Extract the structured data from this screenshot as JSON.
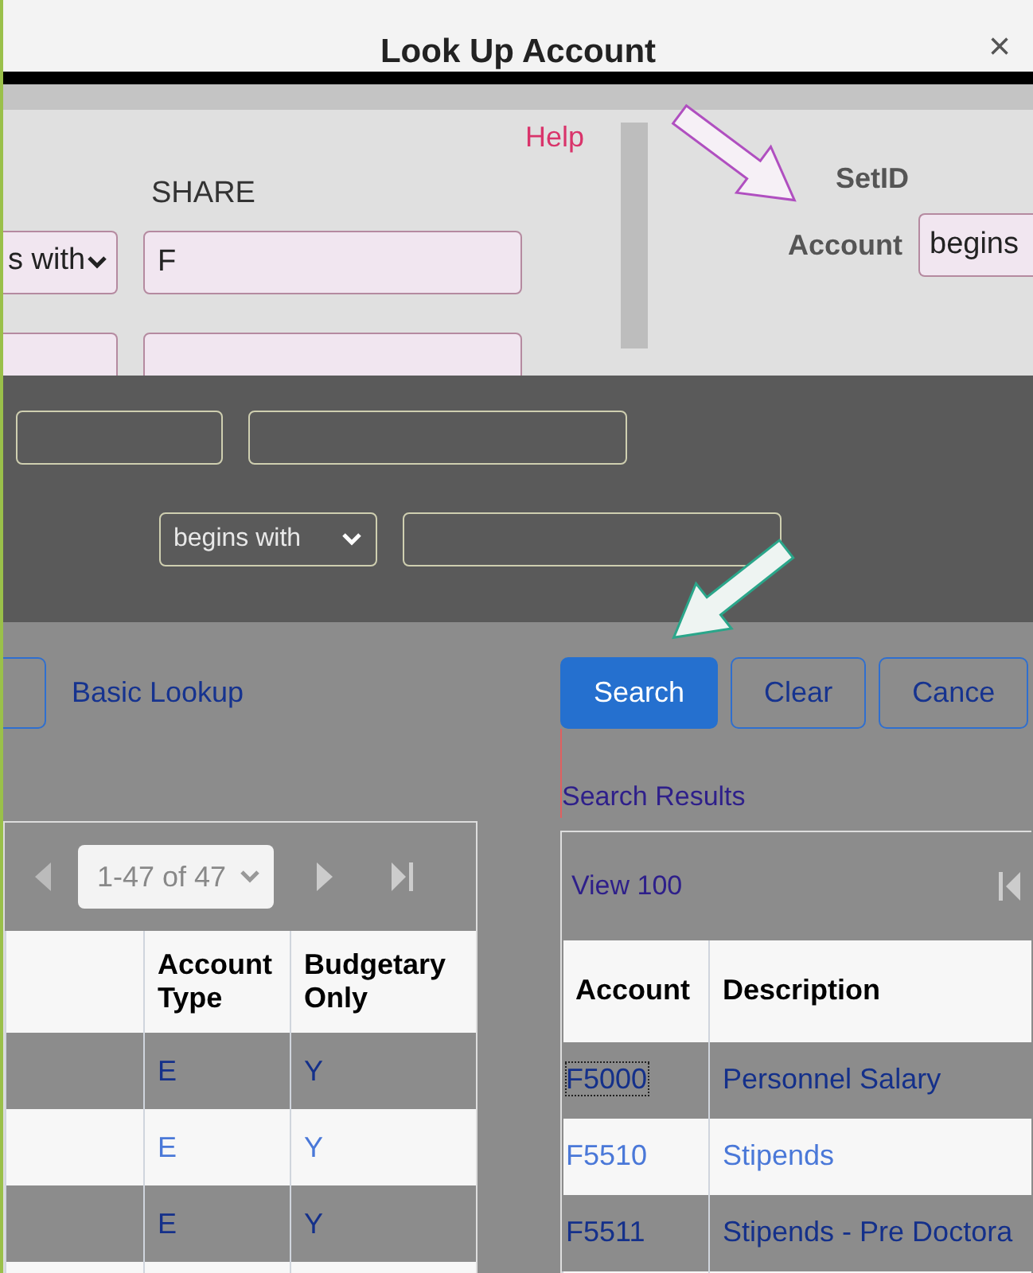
{
  "window": {
    "title": "Look Up Account",
    "close": "×"
  },
  "help_link": "Help",
  "left_form": {
    "label": "SHARE",
    "operator": "s with",
    "value": "F"
  },
  "right_form": {
    "setid_label": "SetID",
    "account_label": "Account",
    "operator": "begins"
  },
  "middle_form": {
    "operator": "begins with"
  },
  "basic_lookup": "Basic Lookup",
  "buttons": [
    {
      "label": "Search",
      "kind": "primary"
    },
    {
      "label": "Clear",
      "kind": "outline"
    },
    {
      "label": "Cance",
      "kind": "outline"
    }
  ],
  "search_results_title": "Search Results",
  "left_grid": {
    "pager": "1-47 of 47",
    "columns": [
      "Account Type",
      "Budgetary Only"
    ],
    "rows": [
      [
        "E",
        "Y"
      ],
      [
        "E",
        "Y"
      ],
      [
        "E",
        "Y"
      ]
    ]
  },
  "right_grid": {
    "view": "View 100",
    "columns": [
      "Account",
      "Description"
    ],
    "rows": [
      {
        "account": "F5000",
        "description": "Personnel Salary",
        "focused": true
      },
      {
        "account": "F5510",
        "description": "Stipends",
        "focused": false
      },
      {
        "account": "F5511",
        "description": "Stipends - Pre Doctora",
        "focused": false
      }
    ]
  }
}
